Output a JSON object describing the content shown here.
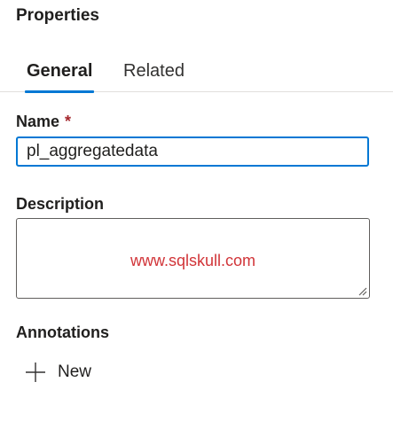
{
  "panel": {
    "title": "Properties"
  },
  "tabs": [
    {
      "label": "General",
      "selected": true
    },
    {
      "label": "Related",
      "selected": false
    }
  ],
  "fields": {
    "name": {
      "label": "Name",
      "required_marker": "*",
      "value": "pl_aggregatedata"
    },
    "description": {
      "label": "Description",
      "value": "",
      "overlay_text": "www.sqlskull.com"
    }
  },
  "annotations": {
    "label": "Annotations",
    "new_button_label": "New",
    "new_button_icon": "plus-icon"
  },
  "colors": {
    "accent": "#0078d4",
    "required": "#a4262c",
    "watermark": "#d13438",
    "text": "#201f1e",
    "divider": "#e1dfdd"
  }
}
